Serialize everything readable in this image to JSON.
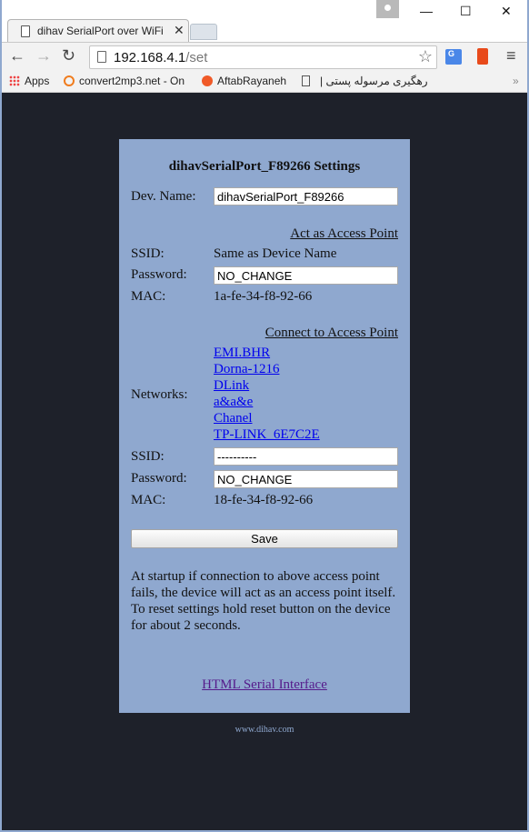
{
  "browser": {
    "tab_title": "dihav SerialPort over WiFi",
    "tab_close": "✕",
    "url_host": "192.168.4.1",
    "url_path": "/set",
    "window_controls": {
      "minimize": "—",
      "maximize": "☐",
      "close": "✕"
    },
    "nav": {
      "back": "←",
      "forward": "→",
      "reload": "↻"
    },
    "star": "☆",
    "menu": "≡",
    "ext_translate_label": "G",
    "bookmarks": [
      {
        "label": "Apps",
        "icon": "apps-icon"
      },
      {
        "label": "convert2mp3.net - On",
        "icon": "convert2mp3-icon"
      },
      {
        "label": "AftabRayaneh",
        "icon": "aftabrayaneh-icon"
      },
      {
        "label": "",
        "icon": "page-icon"
      },
      {
        "label": "| رهگیری مرسوله پستی",
        "icon": ""
      }
    ],
    "bookmarks_overflow": "»"
  },
  "page": {
    "heading": "dihavSerialPort_F89266 Settings",
    "dev_name_label": "Dev. Name:",
    "dev_name_value": "dihavSerialPort_F89266",
    "ap_section": {
      "title": "Act as Access Point",
      "ssid_label": "SSID:",
      "ssid_value": "Same as Device Name",
      "password_label": "Password:",
      "password_value": "NO_CHANGE",
      "mac_label": "MAC:",
      "mac_value": "1a-fe-34-f8-92-66"
    },
    "sta_section": {
      "title": "Connect to Access Point",
      "networks_label": "Networks:",
      "networks": [
        "EMI.BHR",
        "Dorna-1216",
        "DLink",
        "a&a&e",
        "Chanel",
        "TP-LINK_6E7C2E"
      ],
      "ssid_label": "SSID:",
      "ssid_value": "----------",
      "password_label": "Password:",
      "password_value": "NO_CHANGE",
      "mac_label": "MAC:",
      "mac_value": "18-fe-34-f8-92-66"
    },
    "save_label": "Save",
    "info_line1": "At startup if connection to above access point fails, the device will act as an access point itself.",
    "info_line2": "To reset settings hold reset button on the device for about 2 seconds.",
    "serial_link": "HTML Serial Interface",
    "footer": "www.dihav.com"
  }
}
